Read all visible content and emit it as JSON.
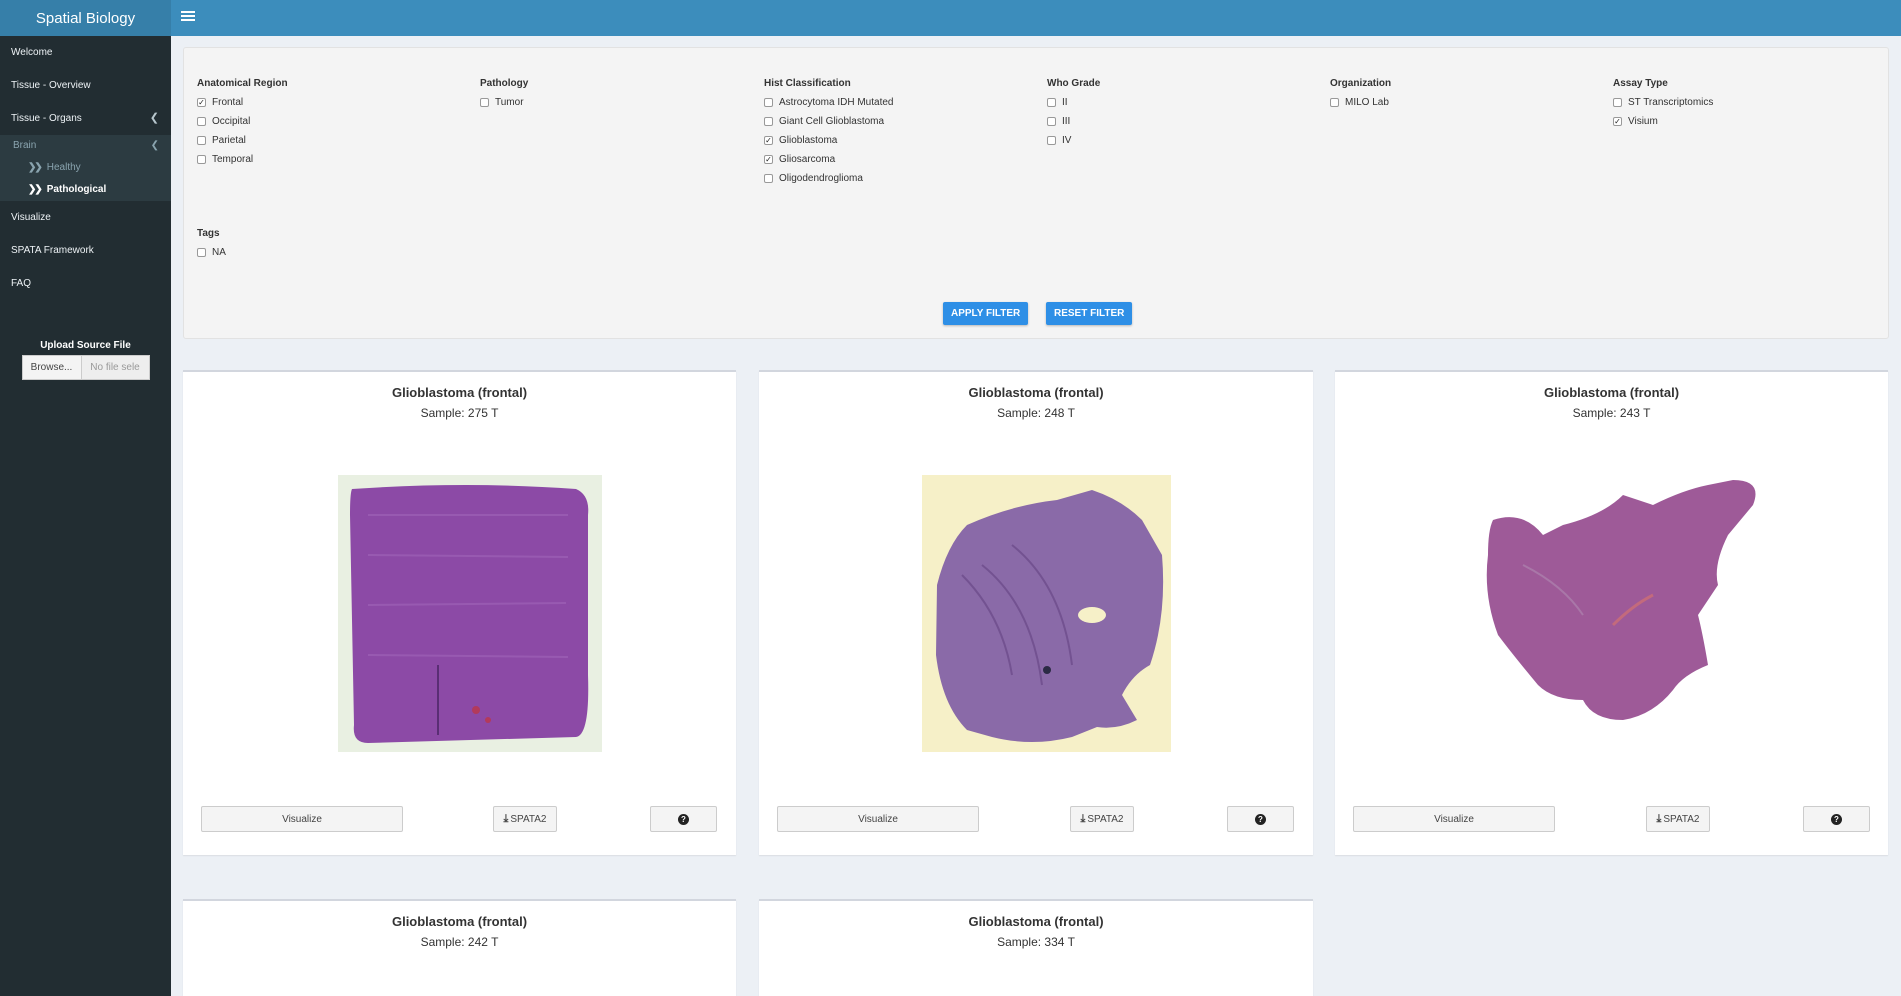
{
  "app": {
    "title": "Spatial Biology"
  },
  "sidebar": {
    "items": [
      {
        "label": "Welcome"
      },
      {
        "label": "Tissue - Overview"
      },
      {
        "label": "Tissue - Organs"
      }
    ],
    "brain": {
      "label": "Brain",
      "children": [
        {
          "label": "Healthy"
        },
        {
          "label": "Pathological"
        }
      ]
    },
    "items_after": [
      {
        "label": "Visualize"
      },
      {
        "label": "SPATA Framework"
      },
      {
        "label": "FAQ"
      }
    ],
    "upload": {
      "title": "Upload Source File",
      "browse_label": "Browse...",
      "file_placeholder": "No file sele"
    }
  },
  "filters": {
    "anatomical_region": {
      "heading": "Anatomical Region",
      "options": [
        {
          "label": "Frontal",
          "checked": true
        },
        {
          "label": "Occipital",
          "checked": false
        },
        {
          "label": "Parietal",
          "checked": false
        },
        {
          "label": "Temporal",
          "checked": false
        }
      ]
    },
    "pathology": {
      "heading": "Pathology",
      "options": [
        {
          "label": "Tumor",
          "checked": false
        }
      ]
    },
    "hist_classification": {
      "heading": "Hist Classification",
      "options": [
        {
          "label": "Astrocytoma IDH Mutated",
          "checked": false
        },
        {
          "label": "Giant Cell Glioblastoma",
          "checked": false
        },
        {
          "label": "Glioblastoma",
          "checked": true
        },
        {
          "label": "Gliosarcoma",
          "checked": true
        },
        {
          "label": "Oligodendroglioma",
          "checked": false
        }
      ]
    },
    "who_grade": {
      "heading": "Who Grade",
      "options": [
        {
          "label": "II",
          "checked": false
        },
        {
          "label": "III",
          "checked": false
        },
        {
          "label": "IV",
          "checked": false
        }
      ]
    },
    "organization": {
      "heading": "Organization",
      "options": [
        {
          "label": "MILO Lab",
          "checked": false
        }
      ]
    },
    "assay_type": {
      "heading": "Assay Type",
      "options": [
        {
          "label": "ST Transcriptomics",
          "checked": false
        },
        {
          "label": "Visium",
          "checked": true
        }
      ]
    },
    "tags": {
      "heading": "Tags",
      "options": [
        {
          "label": "NA",
          "checked": false
        }
      ]
    },
    "apply_label": "APPLY FILTER",
    "reset_label": "RESET FILTER"
  },
  "cards": [
    {
      "title": "Glioblastoma (frontal)",
      "sample": "Sample: 275 T"
    },
    {
      "title": "Glioblastoma (frontal)",
      "sample": "Sample: 248 T"
    },
    {
      "title": "Glioblastoma (frontal)",
      "sample": "Sample: 243 T"
    },
    {
      "title": "Glioblastoma (frontal)",
      "sample": "Sample: 242 T"
    },
    {
      "title": "Glioblastoma (frontal)",
      "sample": "Sample: 334 T"
    }
  ],
  "card_buttons": {
    "visualize": "Visualize",
    "download": "SPATA2"
  },
  "colors": {
    "header": "#3c8dbc",
    "logo": "#367fa9",
    "sidebar": "#222d32",
    "primary_button": "#2e8fe6",
    "tissue_stain": "#8a5aa8"
  }
}
